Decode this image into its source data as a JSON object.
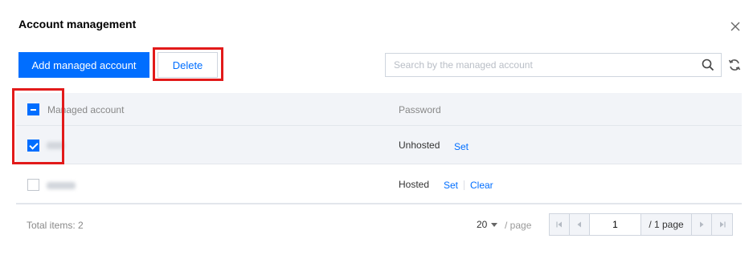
{
  "dialog": {
    "title": "Account management"
  },
  "toolbar": {
    "add_label": "Add managed account",
    "delete_label": "Delete",
    "search_placeholder": "Search by the managed account"
  },
  "table": {
    "columns": [
      "Managed account",
      "Password"
    ],
    "header_checkbox": "partial",
    "rows": [
      {
        "selected": true,
        "account": "",
        "password_status": "Unhosted",
        "actions": [
          "Set"
        ]
      },
      {
        "selected": false,
        "account": "",
        "password_status": "Hosted",
        "actions": [
          "Set",
          "Clear"
        ]
      }
    ]
  },
  "pagination": {
    "total_label": "Total items: 2",
    "page_size": "20",
    "per_page_label": "/ page",
    "current_page": "1",
    "total_pages_label": "/ 1 page"
  },
  "colors": {
    "primary": "#006eff",
    "highlight": "#e21a1a",
    "header_bg": "#f2f4f8"
  },
  "icons": [
    "close-icon",
    "search-icon",
    "refresh-icon",
    "first-page-icon",
    "prev-page-icon",
    "next-page-icon",
    "last-page-icon"
  ]
}
